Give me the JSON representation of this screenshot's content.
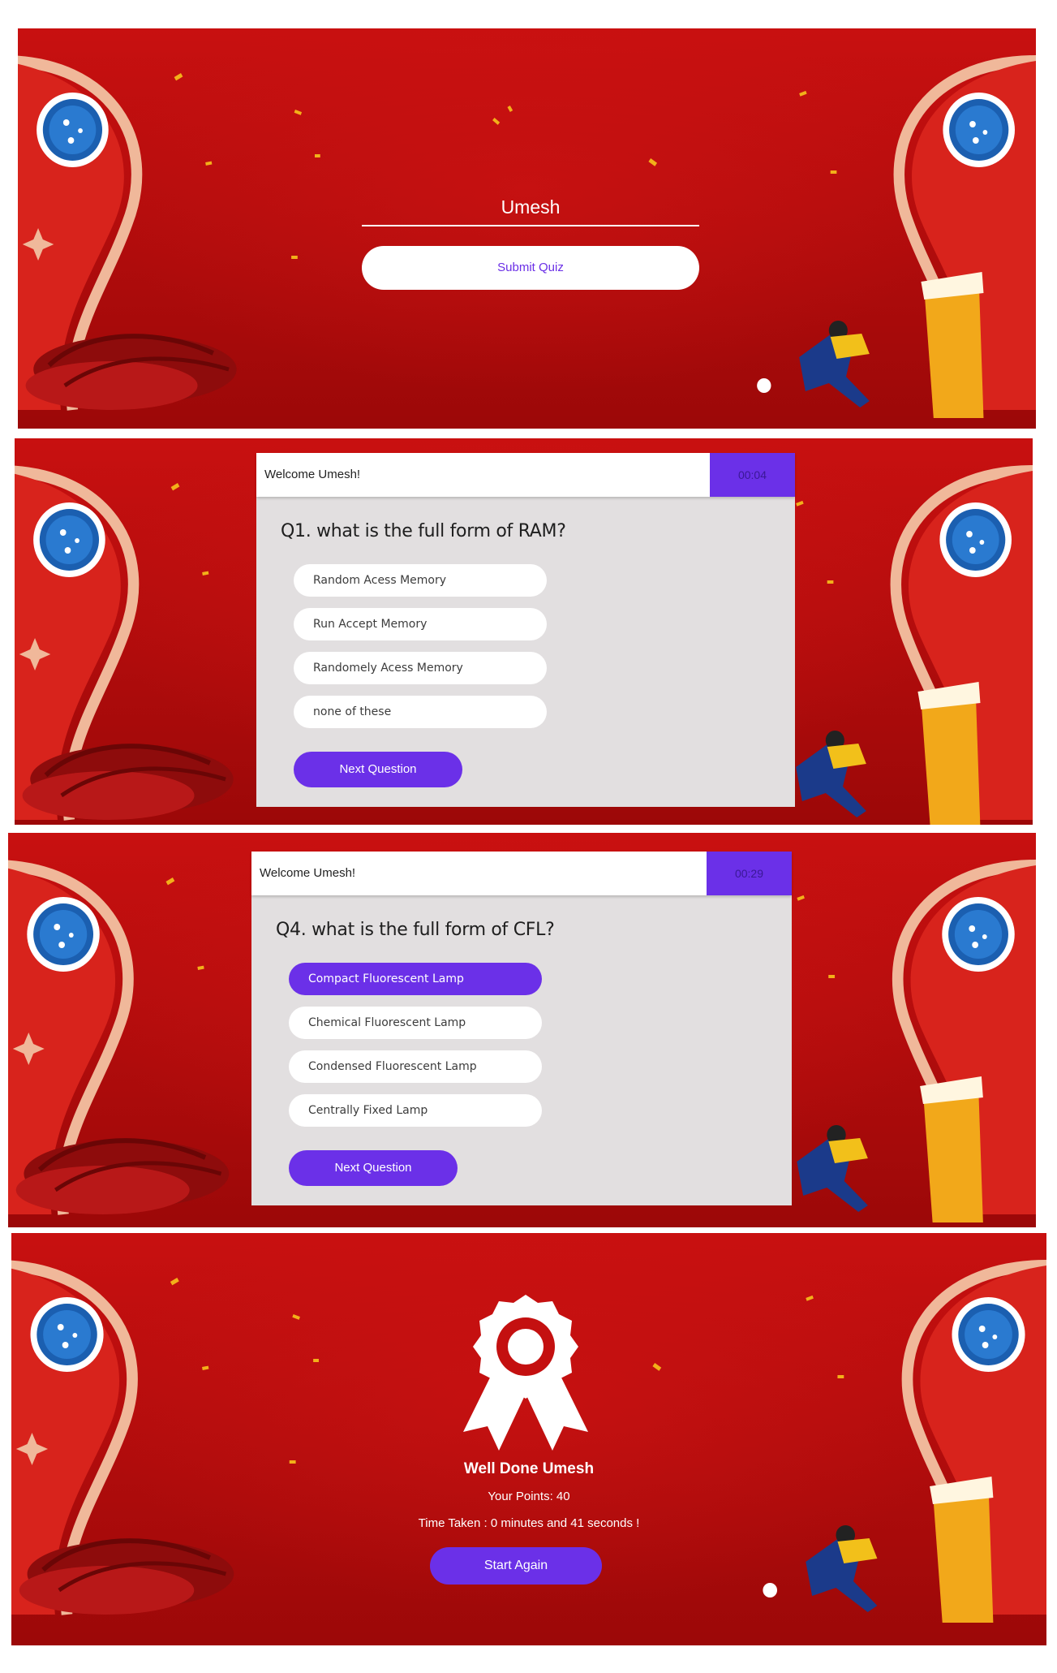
{
  "screen_login": {
    "name_value": "Umesh",
    "submit_label": "Submit Quiz"
  },
  "screen_q1": {
    "welcome": "Welcome Umesh!",
    "timer": "00:04",
    "question": "Q1. what is the full form of RAM?",
    "options": [
      {
        "label": "Random Acess Memory",
        "selected": false
      },
      {
        "label": "Run Accept Memory",
        "selected": false
      },
      {
        "label": "Randomely Acess Memory",
        "selected": false
      },
      {
        "label": "none of these",
        "selected": false
      }
    ],
    "next_label": "Next Question"
  },
  "screen_q4": {
    "welcome": "Welcome Umesh!",
    "timer": "00:29",
    "question": "Q4. what is the full form of CFL?",
    "options": [
      {
        "label": "Compact Fluorescent Lamp",
        "selected": true
      },
      {
        "label": "Chemical Fluorescent Lamp",
        "selected": false
      },
      {
        "label": "Condensed Fluorescent Lamp",
        "selected": false
      },
      {
        "label": "Centrally Fixed Lamp",
        "selected": false
      }
    ],
    "next_label": "Next Question"
  },
  "screen_result": {
    "title": "Well Done Umesh",
    "points": "Your Points: 40",
    "time_taken": "Time Taken : 0 minutes and 41 seconds !",
    "start_again_label": "Start Again",
    "icon": "award-ribbon-icon"
  },
  "colors": {
    "accent_purple": "#6b30e8",
    "background_red": "#c00c0c",
    "card_gray": "#e2dfe0"
  }
}
